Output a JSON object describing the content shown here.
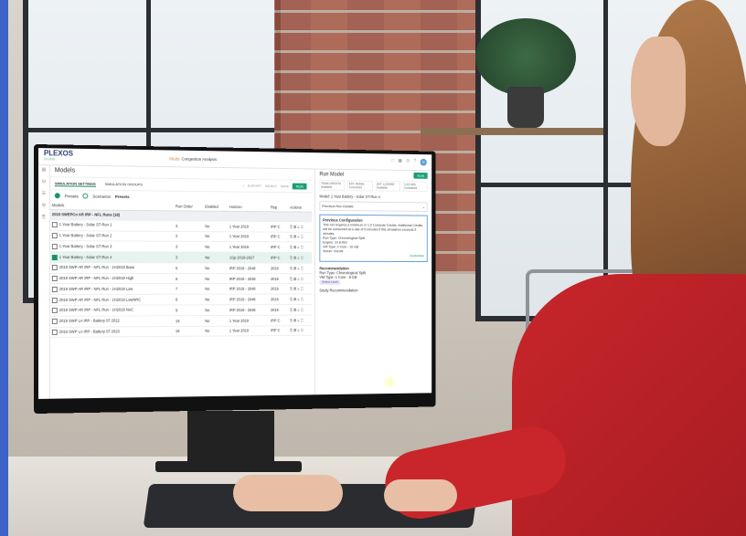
{
  "app": {
    "logo": "PLEXOS",
    "logo_sub": "CLOUD",
    "study_label": "Study:",
    "study_name": "Congestion Analysis",
    "avatar": "M"
  },
  "models": {
    "title": "Models",
    "tabs": [
      "SIMULATION SETTINGS",
      "SIMULATION GROUPS"
    ],
    "toolbar": {
      "export": "EXPORT",
      "ready": "READY",
      "save": "SAVE",
      "run": "RUN"
    },
    "presets_radio": "Presets",
    "scenarios_radio": "Scenarios",
    "presets_title": "Presets",
    "columns": [
      "Models",
      "Run Order",
      "Enabled",
      "Horizon",
      "Rep",
      "Actions"
    ],
    "group": "2019 SWEPCo AR IRP - NFL Runs (18)",
    "rows": [
      {
        "name": "1 Year Battery - Solar ST-Run 1",
        "order": "3",
        "enabled": "No",
        "horizon": "1 Year 2019",
        "rep": "IRP C"
      },
      {
        "name": "1 Year Battery - Solar ST-Run 2",
        "order": "2",
        "enabled": "No",
        "horizon": "1 Year 2019",
        "rep": "IRP C"
      },
      {
        "name": "1 Year Battery - Solar ST-Run 3",
        "order": "3",
        "enabled": "No",
        "horizon": "1 Year 2019",
        "rep": "IRP C"
      },
      {
        "name": "1 Year Battery - Solar ST-Run 4",
        "order": "3",
        "enabled": "No",
        "horizon": "1Gp 2019-2027",
        "rep": "IRP C"
      },
      {
        "name": "2019 SWP AR IRP - NFL Run - 1H2019 Base",
        "order": "5",
        "enabled": "No",
        "horizon": "IRP 2019 - 2048",
        "rep": "2019"
      },
      {
        "name": "2019 SWP AR IRP - NFL Run - 1H2019 High",
        "order": "6",
        "enabled": "No",
        "horizon": "IRP 2019 - 2048",
        "rep": "2019"
      },
      {
        "name": "2019 SWP AR IRP - NFL Run - 1H2019 Low",
        "order": "7",
        "enabled": "No",
        "horizon": "IRP 2019 - 2048",
        "rep": "2019"
      },
      {
        "name": "2019 SWP AR IRP - NFL Run - 1H2019 LowNRC",
        "order": "8",
        "enabled": "No",
        "horizon": "IRP 2019 - 2048",
        "rep": "2019"
      },
      {
        "name": "2019 SWP AR IRP - NFL Run - 1H2019 NoC",
        "order": "9",
        "enabled": "No",
        "horizon": "IRP 2019 - 2048",
        "rep": "2019"
      },
      {
        "name": "2019 SWP LA IRP - Battery 07 2022",
        "order": "15",
        "enabled": "No",
        "horizon": "1 Year 2019",
        "rep": "IRP C"
      },
      {
        "name": "2019 SWP LA IRP - Battery 07 2023",
        "order": "16",
        "enabled": "No",
        "horizon": "1 Year 2019",
        "rep": "IRP C"
      }
    ],
    "selected_index": 3
  },
  "run_panel": {
    "title": "Run Model",
    "run": "RUN",
    "credits": [
      "TEAM CREDITS Available",
      "EST. MODEL Consumed",
      "EST. LICENSE Available",
      "2.00 HRS Consumed"
    ],
    "model_label": "Model:",
    "model_value": "1 Year Battery - Solar ST-Run 4",
    "prev_details": "Previous Run Details",
    "prev_conf_title": "Previous Configuration",
    "prev_conf_text": "This run requires a minimum of 1.5 Compute Credits. Additional Credits will be consumed at a rate of 5 minutes if this simulation exceeds 5 minutes.",
    "run_type": "Run Type: Chronological Split",
    "engine": "Engine: 10.8 R01",
    "vm_type": "VM Type: 2 Core - 16 GB",
    "solver": "Solver: Gurobi",
    "customize": "Customize",
    "recommendation": "Recommendation",
    "reco_runtype": "Run Type: Chronological Split",
    "reco_vm": "VM Type: 1 Core - 8 GB",
    "reco_badge": "Select Level",
    "study_reco": "Study Recommendation"
  }
}
